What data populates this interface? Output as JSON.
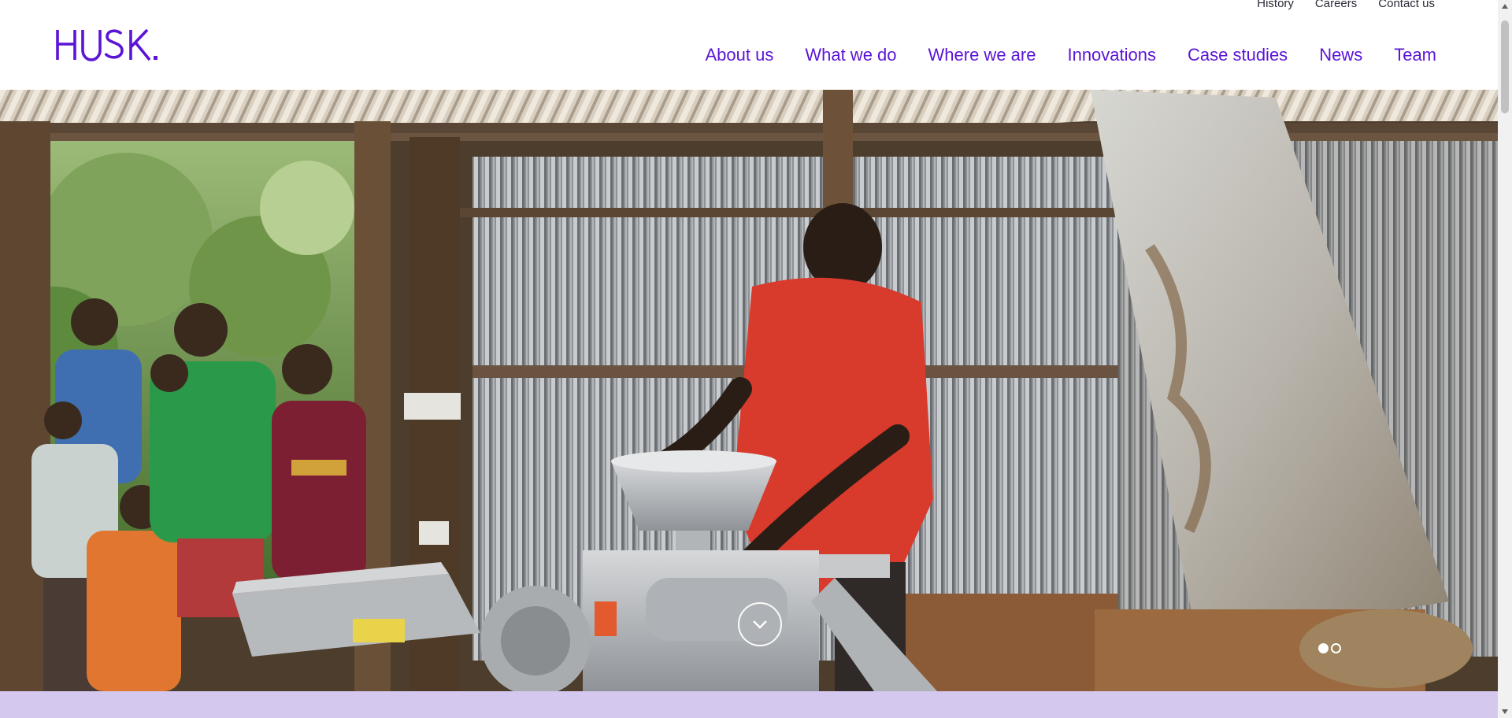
{
  "brand": {
    "name": "HUSK.",
    "accent": "#5b14d6",
    "band_color": "#d4c8ef"
  },
  "utility_nav": [
    "History",
    "Careers",
    "Contact us"
  ],
  "main_nav": [
    "About us",
    "What we do",
    "Where we are",
    "Innovations",
    "Case studies",
    "News",
    "Team"
  ],
  "hero": {
    "image": "photo-of-mill-operator-with-children-in-tin-shed",
    "scroll_icon": "chevron-down-icon",
    "slides": {
      "count": 2,
      "active": 1
    }
  }
}
